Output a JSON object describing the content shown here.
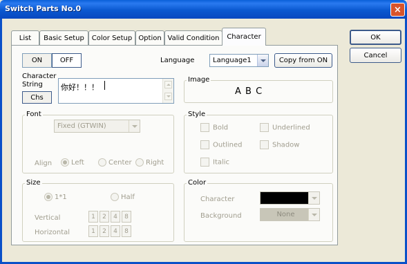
{
  "window": {
    "title": "Switch Parts No.0",
    "close_glyph": "×"
  },
  "tabs": [
    {
      "label": "List"
    },
    {
      "label": "Basic Setup"
    },
    {
      "label": "Color Setup"
    },
    {
      "label": "Option"
    },
    {
      "label": "Valid Condition"
    },
    {
      "label": "Character"
    }
  ],
  "active_tab": "Character",
  "buttons": {
    "ok": "OK",
    "cancel": "Cancel",
    "on": "ON",
    "off": "OFF",
    "copy_from_on": "Copy from ON",
    "chs": "Chs"
  },
  "language": {
    "label": "Language",
    "value": "Language1"
  },
  "character_string": {
    "label_line1": "Character",
    "label_line2": "String",
    "value": "你好！！！"
  },
  "image": {
    "legend": "Image",
    "preview": "A B C"
  },
  "font": {
    "legend": "Font",
    "value": "Fixed (GTWIN)",
    "align_label": "Align",
    "align_options": [
      "Left",
      "Center",
      "Right"
    ],
    "align_selected": "Left"
  },
  "style": {
    "legend": "Style",
    "options": [
      "Bold",
      "Underlined",
      "Outlined",
      "Shadow",
      "Italic"
    ]
  },
  "size": {
    "legend": "Size",
    "options": [
      "1*1",
      "Half"
    ],
    "selected": "1*1",
    "vertical_label": "Vertical",
    "horizontal_label": "Horizontal",
    "multipliers": [
      "1",
      "2",
      "4",
      "8"
    ]
  },
  "color": {
    "legend": "Color",
    "character_label": "Character",
    "character_color": "#000000",
    "background_label": "Background",
    "background_value": "None"
  },
  "colors": {
    "titlebar": "#0a58d0",
    "close_button": "#d8542c",
    "dialog_bg": "#ece9d8"
  }
}
